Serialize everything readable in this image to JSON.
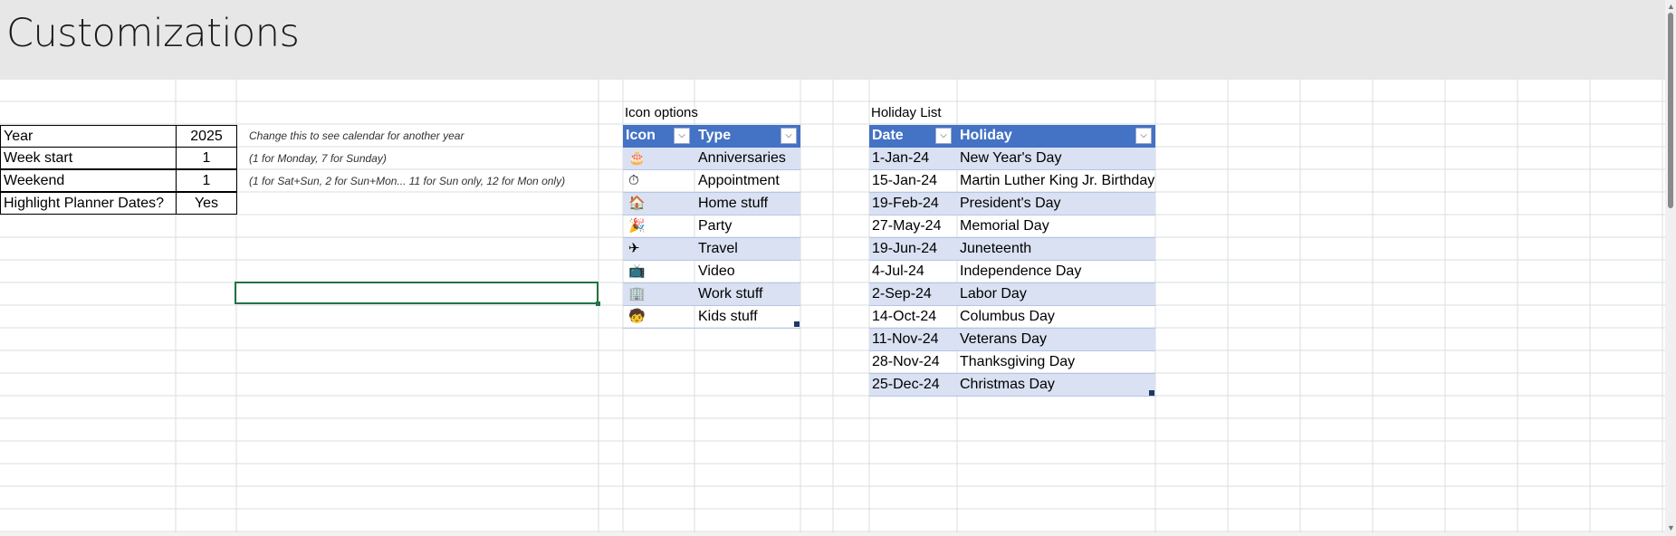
{
  "page": {
    "title": "Customizations"
  },
  "settings": {
    "rows": [
      {
        "label": "Year",
        "value": "2025",
        "note": "Change this to see calendar for another year"
      },
      {
        "label": "Week start",
        "value": "1",
        "note": "(1 for Monday, 7 for Sunday)"
      },
      {
        "label": "Weekend",
        "value": "1",
        "note": "(1 for Sat+Sun, 2 for Sun+Mon... 11 for Sun only, 12 for Mon only)"
      },
      {
        "label": "Highlight Planner Dates?",
        "value": "Yes",
        "note": ""
      }
    ]
  },
  "icon_table": {
    "caption": "Icon options",
    "headers": {
      "icon": "Icon",
      "type": "Type"
    },
    "rows": [
      {
        "icon": "🎂",
        "icon_name": "birthday-cake-icon",
        "type": "Anniversaries"
      },
      {
        "icon": "⏱",
        "icon_name": "stopwatch-icon",
        "type": "Appointment"
      },
      {
        "icon": "🏠",
        "icon_name": "house-icon",
        "type": "Home stuff"
      },
      {
        "icon": "🎉",
        "icon_name": "party-popper-icon",
        "type": "Party"
      },
      {
        "icon": "✈",
        "icon_name": "airplane-icon",
        "type": "Travel"
      },
      {
        "icon": "📺",
        "icon_name": "television-icon",
        "type": "Video"
      },
      {
        "icon": "🏢",
        "icon_name": "office-building-icon",
        "type": "Work stuff"
      },
      {
        "icon": "🧒",
        "icon_name": "child-icon",
        "type": "Kids stuff"
      }
    ]
  },
  "holiday_table": {
    "caption": "Holiday List",
    "headers": {
      "date": "Date",
      "holiday": "Holiday"
    },
    "rows": [
      {
        "date": "1-Jan-24",
        "holiday": "New Year's Day"
      },
      {
        "date": "15-Jan-24",
        "holiday": "Martin Luther King Jr. Birthday"
      },
      {
        "date": "19-Feb-24",
        "holiday": "President's Day"
      },
      {
        "date": "27-May-24",
        "holiday": "Memorial Day"
      },
      {
        "date": "19-Jun-24",
        "holiday": "Juneteenth"
      },
      {
        "date": "4-Jul-24",
        "holiday": "Independence Day"
      },
      {
        "date": "2-Sep-24",
        "holiday": "Labor Day"
      },
      {
        "date": "14-Oct-24",
        "holiday": "Columbus Day"
      },
      {
        "date": "11-Nov-24",
        "holiday": "Veterans Day"
      },
      {
        "date": "28-Nov-24",
        "holiday": "Thanksgiving Day"
      },
      {
        "date": "25-Dec-24",
        "holiday": "Christmas Day"
      }
    ]
  },
  "theme": {
    "header_band": "#e7e7e7",
    "table_header": "#4472c4",
    "table_band": "#d9e1f2",
    "selection": "#217346"
  }
}
